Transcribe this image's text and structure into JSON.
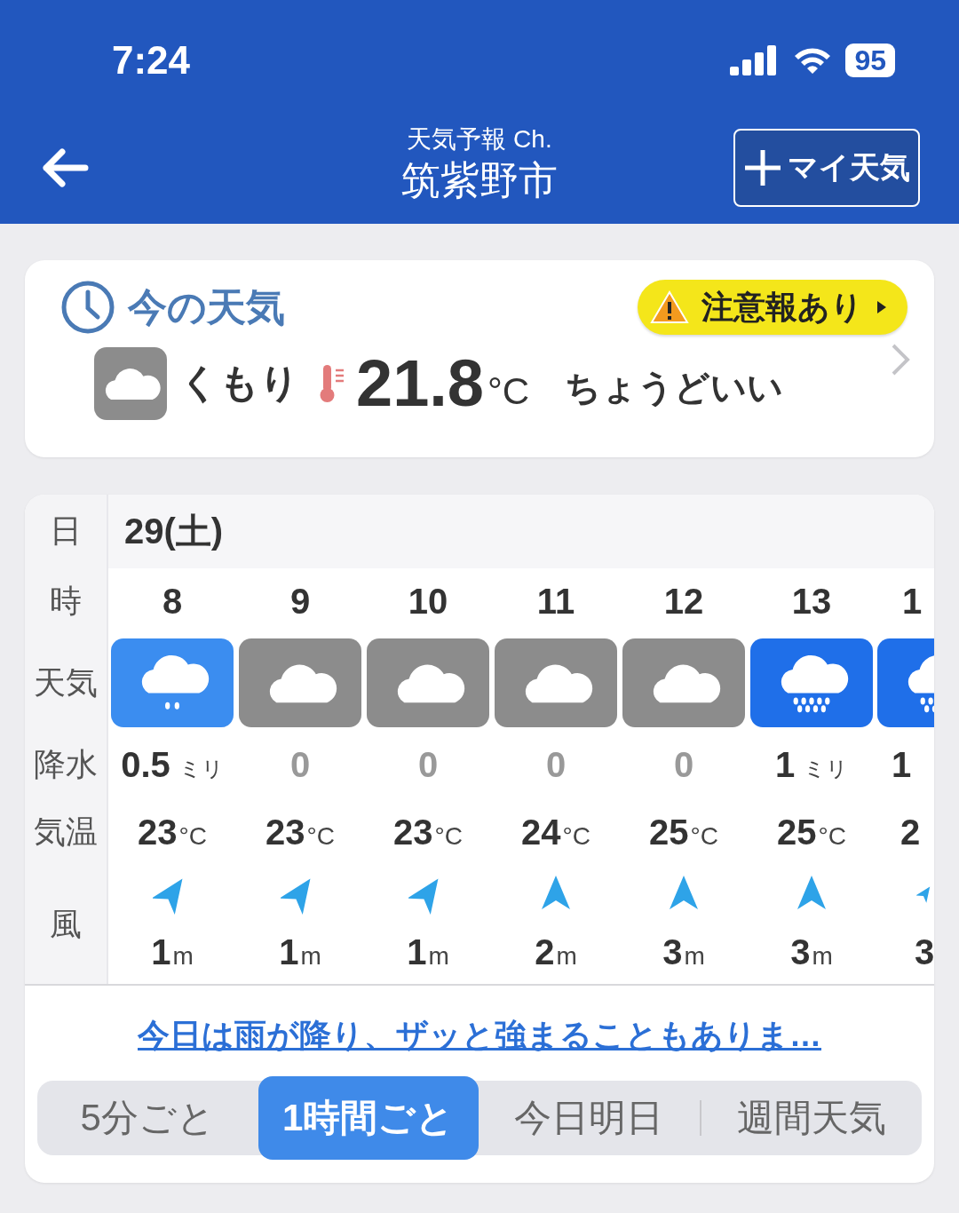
{
  "status_bar": {
    "time": "7:24",
    "battery": "95"
  },
  "header": {
    "subtitle": "天気予報 Ch.",
    "title": "筑紫野市",
    "my_weather_button": "マイ天気"
  },
  "current": {
    "title": "今の天気",
    "alert": "注意報あり",
    "condition": {
      "kind": "cloudy",
      "label": "くもり"
    },
    "temperature": "21.8",
    "temperature_unit": "°C",
    "feeling": "ちょうどいい"
  },
  "forecast": {
    "row_labels": {
      "day": "日",
      "hour": "時",
      "weather": "天気",
      "precipitation": "降水",
      "temperature": "気温",
      "wind": "風"
    },
    "date": "29(土)",
    "hours": [
      {
        "hour": "8",
        "weather": {
          "kind": "light_rain"
        },
        "precipitation": "0.5",
        "precipitation_unit": "ミリ",
        "dry": false,
        "temperature": "23",
        "temperature_unit": "°C",
        "wind_arrow": {
          "kind": "northeast"
        },
        "wind_speed": "1",
        "wind_unit": "m",
        "cut": false
      },
      {
        "hour": "9",
        "weather": {
          "kind": "cloudy"
        },
        "precipitation": "0",
        "dry": true,
        "temperature": "23",
        "temperature_unit": "°C",
        "wind_arrow": {
          "kind": "northeast"
        },
        "wind_speed": "1",
        "wind_unit": "m",
        "cut": false
      },
      {
        "hour": "10",
        "weather": {
          "kind": "cloudy"
        },
        "precipitation": "0",
        "dry": true,
        "temperature": "23",
        "temperature_unit": "°C",
        "wind_arrow": {
          "kind": "northeast"
        },
        "wind_speed": "1",
        "wind_unit": "m",
        "cut": false
      },
      {
        "hour": "11",
        "weather": {
          "kind": "cloudy"
        },
        "precipitation": "0",
        "dry": true,
        "temperature": "24",
        "temperature_unit": "°C",
        "wind_arrow": {
          "kind": "north"
        },
        "wind_speed": "2",
        "wind_unit": "m",
        "cut": false
      },
      {
        "hour": "12",
        "weather": {
          "kind": "cloudy"
        },
        "precipitation": "0",
        "dry": true,
        "temperature": "25",
        "temperature_unit": "°C",
        "wind_arrow": {
          "kind": "north"
        },
        "wind_speed": "3",
        "wind_unit": "m",
        "cut": false
      },
      {
        "hour": "13",
        "weather": {
          "kind": "rain"
        },
        "precipitation": "1",
        "precipitation_unit": "ミリ",
        "dry": false,
        "temperature": "25",
        "temperature_unit": "°C",
        "wind_arrow": {
          "kind": "north"
        },
        "wind_speed": "3",
        "wind_unit": "m",
        "cut": false
      },
      {
        "hour": "1",
        "weather": {
          "kind": "rain"
        },
        "precipitation": "1",
        "dry": false,
        "temperature": "2",
        "wind_arrow": {
          "kind": "northeast"
        },
        "wind_speed": "3",
        "cut": true
      }
    ],
    "summary_link": "今日は雨が降り、ザッと強まることもありま…",
    "tabs": [
      {
        "label": "5分ごと",
        "selected": false
      },
      {
        "label": "1時間ごと",
        "selected": true
      },
      {
        "label": "今日明日",
        "selected": false
      },
      {
        "label": "週間天気",
        "selected": false
      }
    ]
  }
}
